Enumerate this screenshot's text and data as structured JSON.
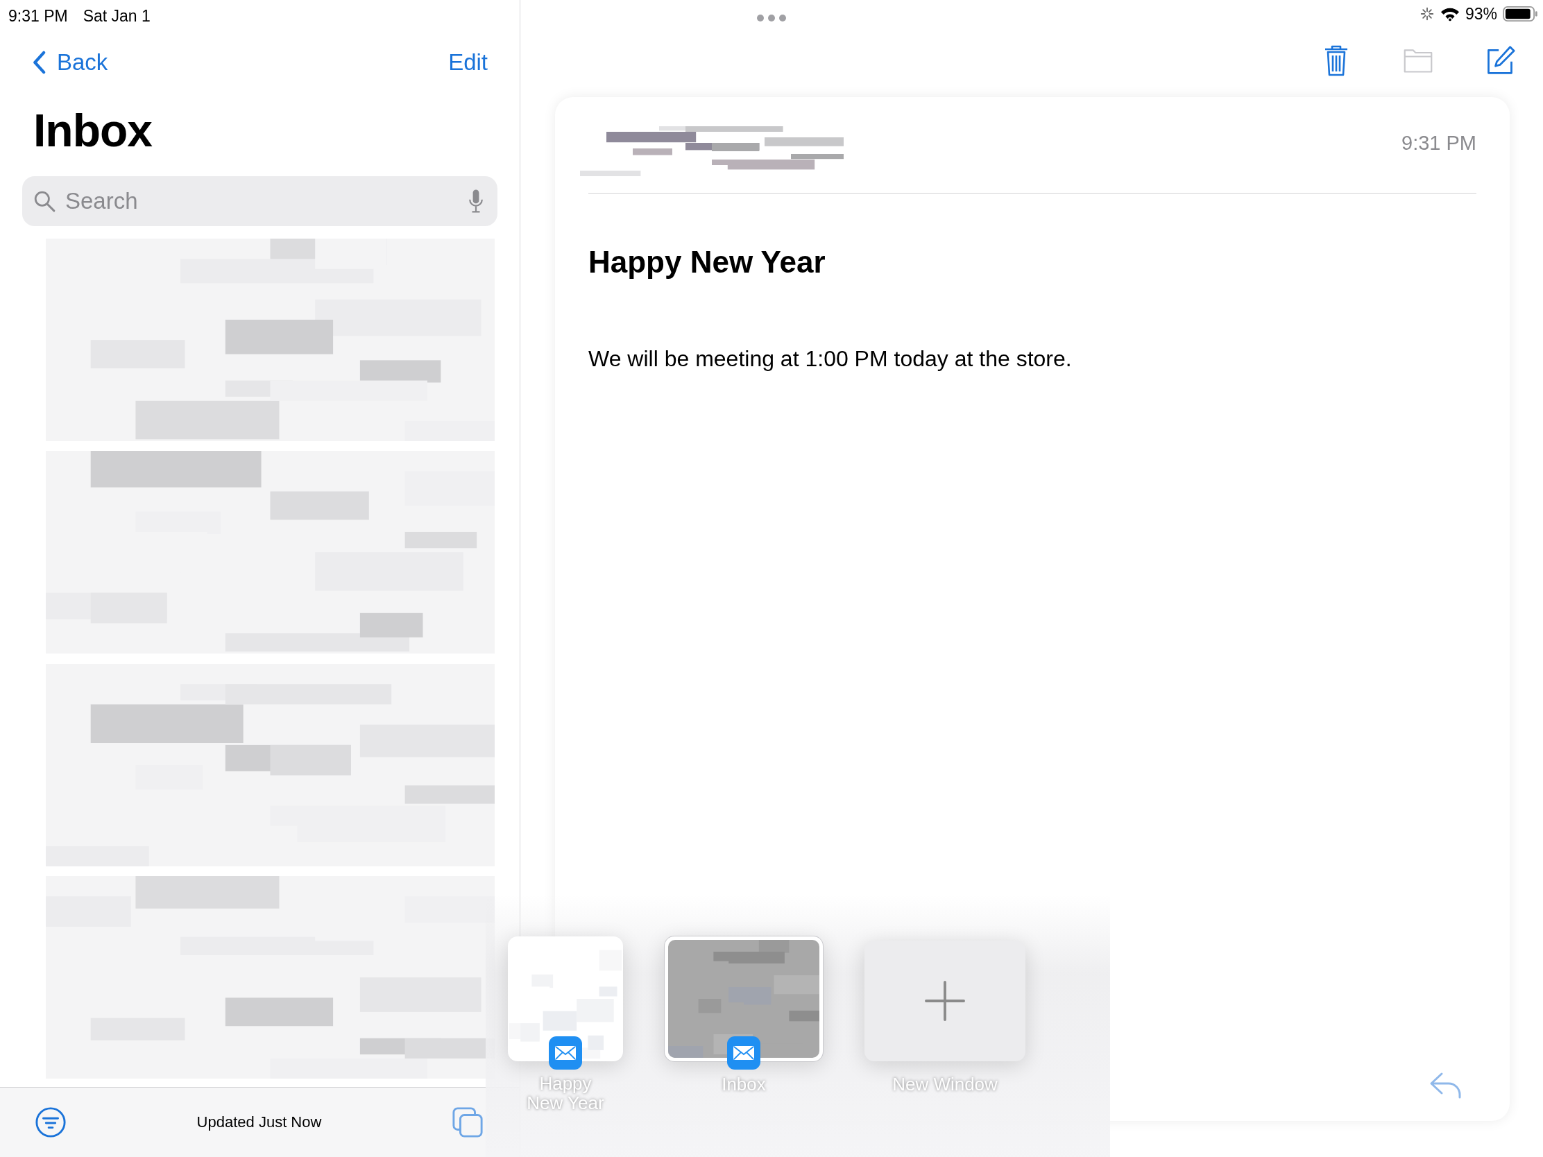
{
  "status_bar": {
    "time": "9:31 PM",
    "date": "Sat Jan 1",
    "battery": "93%"
  },
  "sidebar": {
    "back": "Back",
    "edit": "Edit",
    "title": "Inbox",
    "search": {
      "placeholder": "Search"
    },
    "status": "Updated Just Now"
  },
  "toolbar": [
    {
      "kind": "trash",
      "disabled": false
    },
    {
      "kind": "folder",
      "disabled": true
    },
    {
      "kind": "compose",
      "disabled": false
    }
  ],
  "message": {
    "time": "9:31 PM",
    "subject": "Happy New Year",
    "body": "We will be meeting at 1:00 PM today at the store."
  },
  "shelf": [
    {
      "kind": "window",
      "label": "Happy New Year",
      "selected": false
    },
    {
      "kind": "window",
      "label": "Inbox",
      "selected": true
    },
    {
      "kind": "new",
      "label": "New Window",
      "selected": false
    }
  ]
}
